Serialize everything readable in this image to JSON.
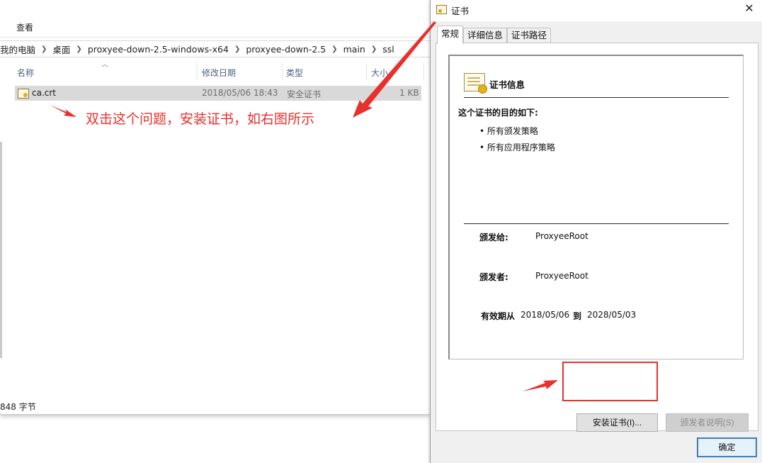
{
  "explorer": {
    "ribbon_tab": "查看",
    "breadcrumb": [
      "我的电脑",
      "桌面",
      "proxyee-down-2.5-windows-x64",
      "proxyee-down-2.5",
      "main",
      "ssl"
    ],
    "columns": {
      "name": "名称",
      "modified": "修改日期",
      "type": "类型",
      "size": "大小"
    },
    "file": {
      "name": "ca.crt",
      "modified": "2018/05/06 18:43",
      "type": "安全证书",
      "size": "1 KB"
    },
    "status": "848 字节"
  },
  "annotation": {
    "text": "双击这个问题，安装证书，如右图所示",
    "color": "#e8302c"
  },
  "dialog": {
    "title": "证书",
    "tabs": [
      "常规",
      "详细信息",
      "证书路径"
    ],
    "info_title": "证书信息",
    "purpose_label": "这个证书的目的如下:",
    "purposes": [
      "所有颁发策略",
      "所有应用程序策略"
    ],
    "issued_to_label": "颁发给:",
    "issued_to": "ProxyeeRoot",
    "issued_by_label": "颁发者:",
    "issued_by": "ProxyeeRoot",
    "valid_from_label": "有效期从",
    "valid_from": "2018/05/06",
    "valid_to_label": "到",
    "valid_to": "2028/05/03",
    "install_button": "安装证书(I)...",
    "issuer_statement_button": "颁发者说明(S)",
    "ok_button": "确定",
    "close_glyph": "✕"
  }
}
